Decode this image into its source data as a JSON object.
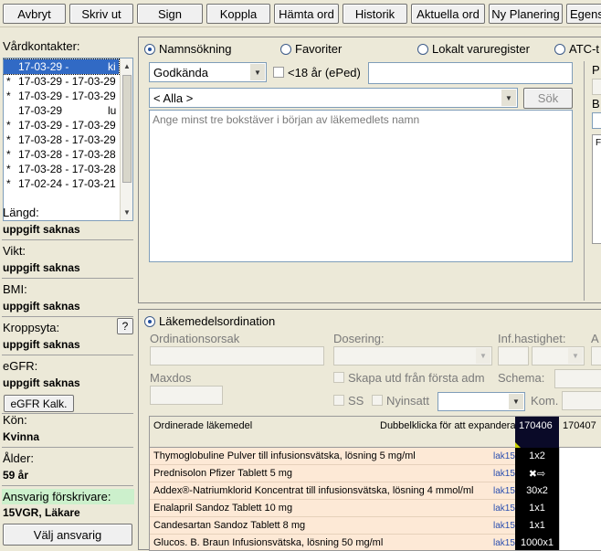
{
  "toolbar": {
    "buttons": [
      "Avbryt",
      "Skriv ut",
      "Sign",
      "Koppla",
      "Hämta ord",
      "Historik",
      "Aktuella ord",
      "Ny Planering",
      "Egens"
    ]
  },
  "left": {
    "vardkontakter_label": "Vårdkontakter:",
    "visits": [
      {
        "mark": "",
        "text": "17-03-29 -",
        "extra": "ki",
        "selected": true
      },
      {
        "mark": "*",
        "text": "17-03-29 - 17-03-29",
        "extra": "",
        "selected": false
      },
      {
        "mark": "*",
        "text": "17-03-29 - 17-03-29",
        "extra": "",
        "selected": false
      },
      {
        "mark": "",
        "text": "17-03-29",
        "extra": "lu",
        "selected": false
      },
      {
        "mark": "*",
        "text": "17-03-29 - 17-03-29",
        "extra": "",
        "selected": false
      },
      {
        "mark": "*",
        "text": "17-03-28 - 17-03-29",
        "extra": "",
        "selected": false
      },
      {
        "mark": "*",
        "text": "17-03-28 - 17-03-28",
        "extra": "",
        "selected": false
      },
      {
        "mark": "*",
        "text": "17-03-28 - 17-03-28",
        "extra": "",
        "selected": false
      },
      {
        "mark": "*",
        "text": "17-02-24 - 17-03-21",
        "extra": "",
        "selected": false
      }
    ],
    "langd_label": "Längd:",
    "langd_value": "uppgift saknas",
    "vikt_label": "Vikt:",
    "vikt_value": "uppgift saknas",
    "bmi_label": "BMI:",
    "bmi_value": "uppgift saknas",
    "kroppsyta_label": "Kroppsyta:",
    "kroppsyta_value": "uppgift saknas",
    "help_label": "?",
    "egfr_label": "eGFR:",
    "egfr_value": "uppgift saknas",
    "egfr_button": "eGFR Kalk.",
    "kon_label": "Kön:",
    "kon_value": "Kvinna",
    "alder_label": "Ålder:",
    "alder_value": "59 år",
    "ansvarig_label": "Ansvarig förskrivare:",
    "ansvarig_value": "15VGR, Läkare",
    "valj_button": "Välj ansvarig"
  },
  "search": {
    "radios": [
      "Namnsökning",
      "Favoriter",
      "Lokalt varuregister",
      "ATC-t"
    ],
    "filter_value": "Godkända",
    "under18_label": "<18 år (ePed)",
    "category_value": "< Alla >",
    "sok_button": "Sök",
    "hint": "Ange minst tre bokstäver i början av läkemedlets namn",
    "right_p": "P",
    "right_b": "B",
    "right_f": "F"
  },
  "order": {
    "title": "Läkemedelsordination",
    "ordinationsorsak_label": "Ordinationsorsak",
    "dosering_label": "Dosering:",
    "infhast_label": "Inf.hastighet:",
    "right_a": "A",
    "maxdos_label": "Maxdos",
    "skapa_label": "Skapa utd från första adm",
    "schema_label": "Schema:",
    "ss_label": "SS",
    "nyinsatt_label": "Nyinsatt",
    "kom_label": "Kom.",
    "table_header": "Ordinerade läkemedel",
    "table_hint": "Dubbelklicka för att expandera",
    "date1": "170406",
    "date2": "170407",
    "lak_tag": "lak15",
    "rows": [
      {
        "name": "Thymoglobuline Pulver till infusionsvätska, lösning 5 mg/ml",
        "dose": "1x2"
      },
      {
        "name": "Prednisolon Pfizer Tablett 5 mg",
        "dose": "✖⇨"
      },
      {
        "name": "Addex®-Natriumklorid Koncentrat till infusionsvätska, lösning 4 mmol/ml",
        "dose": "30x2"
      },
      {
        "name": "Enalapril Sandoz Tablett 10 mg",
        "dose": "1x1"
      },
      {
        "name": "Candesartan Sandoz Tablett 8 mg",
        "dose": "1x1"
      },
      {
        "name": "Glucos. B. Braun Infusionsvätska, lösning 50 mg/ml",
        "dose": "1000x1"
      }
    ]
  }
}
